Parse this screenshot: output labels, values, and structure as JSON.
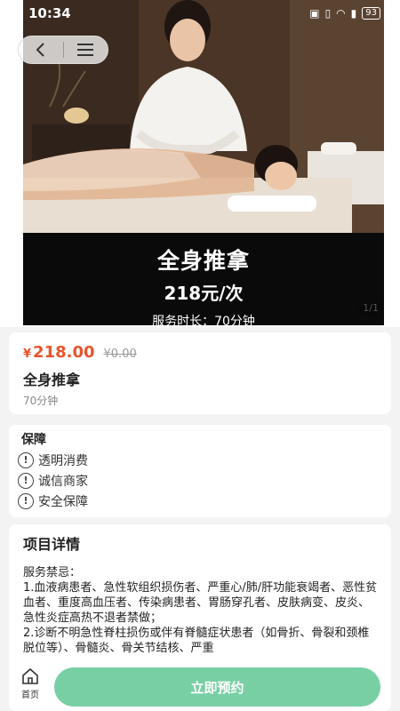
{
  "status_bar": {
    "time": "10:34",
    "battery": "93"
  },
  "hero": {
    "title": "全身推拿",
    "price_line": "218元/次",
    "duration_line": "服务时长：70分钟",
    "image_counter": "1/1"
  },
  "product": {
    "currency": "¥",
    "price": "218.00",
    "original_price": "¥0.00",
    "name": "全身推拿",
    "duration": "70分钟"
  },
  "guarantee": {
    "title": "保障",
    "items": [
      {
        "label": "透明消费",
        "icon": "exclamation-circle-icon"
      },
      {
        "label": "诚信商家",
        "icon": "exclamation-circle-icon"
      },
      {
        "label": "安全保障",
        "icon": "exclamation-circle-icon"
      }
    ]
  },
  "detail": {
    "title": "项目详情",
    "lines": [
      "服务禁忌：",
      "1.血液病患者、急性软组织损伤者、严重心/肺/肝功能衰竭者、恶性贫血者、重度高血压者、传染病患者、胃肠穿孔者、皮肤病变、皮炎、急性炎症高热不退者禁做；",
      "2.诊断不明急性脊柱损伤或伴有脊髓症状患者（如骨折、骨裂和颈椎脱位等）、骨髓炎、骨关节结核、严重"
    ]
  },
  "bottom_bar": {
    "home_label": "首页",
    "book_label": "立即预约"
  },
  "colors": {
    "accent": "#79cfa4",
    "price": "#e8542c"
  }
}
